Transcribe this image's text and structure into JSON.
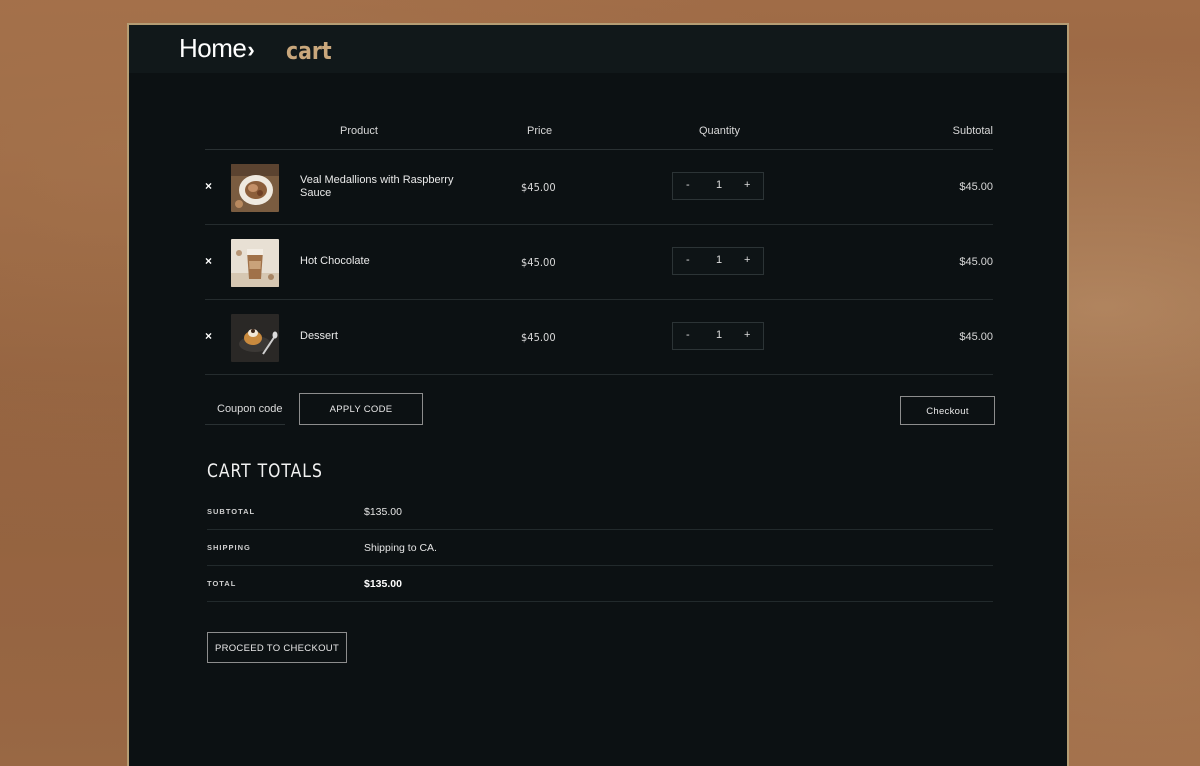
{
  "breadcrumb": {
    "home": "Home",
    "separator": "›",
    "current": "cart"
  },
  "table": {
    "headers": {
      "product": "Product",
      "price": "Price",
      "quantity": "Quantity",
      "subtotal": "Subtotal"
    },
    "rows": [
      {
        "remove": "×",
        "name": "Veal Medallions with Raspberry Sauce",
        "price": "$45.00",
        "qty_minus": "-",
        "qty": "1",
        "qty_plus": "+",
        "subtotal": "$45.00"
      },
      {
        "remove": "×",
        "name": "Hot Chocolate",
        "price": "$45.00",
        "qty_minus": "-",
        "qty": "1",
        "qty_plus": "+",
        "subtotal": "$45.00"
      },
      {
        "remove": "×",
        "name": "Dessert",
        "price": "$45.00",
        "qty_minus": "-",
        "qty": "1",
        "qty_plus": "+",
        "subtotal": "$45.00"
      }
    ]
  },
  "coupon": {
    "label": "Coupon code",
    "apply_label": "APPLY CODE",
    "checkout_label": "Checkout"
  },
  "totals": {
    "title": "CART TOTALS",
    "subtotal_label": "SUBTOTAL",
    "subtotal_value": "$135.00",
    "shipping_label": "SHIPPING",
    "shipping_value": "Shipping to CA.",
    "total_label": "TOTAL",
    "total_value": "$135.00",
    "proceed_label": "PROCEED TO CHECKOUT"
  },
  "colors": {
    "panel": "#0c1113",
    "accent": "#c9a77c",
    "border": "#b59d74"
  }
}
